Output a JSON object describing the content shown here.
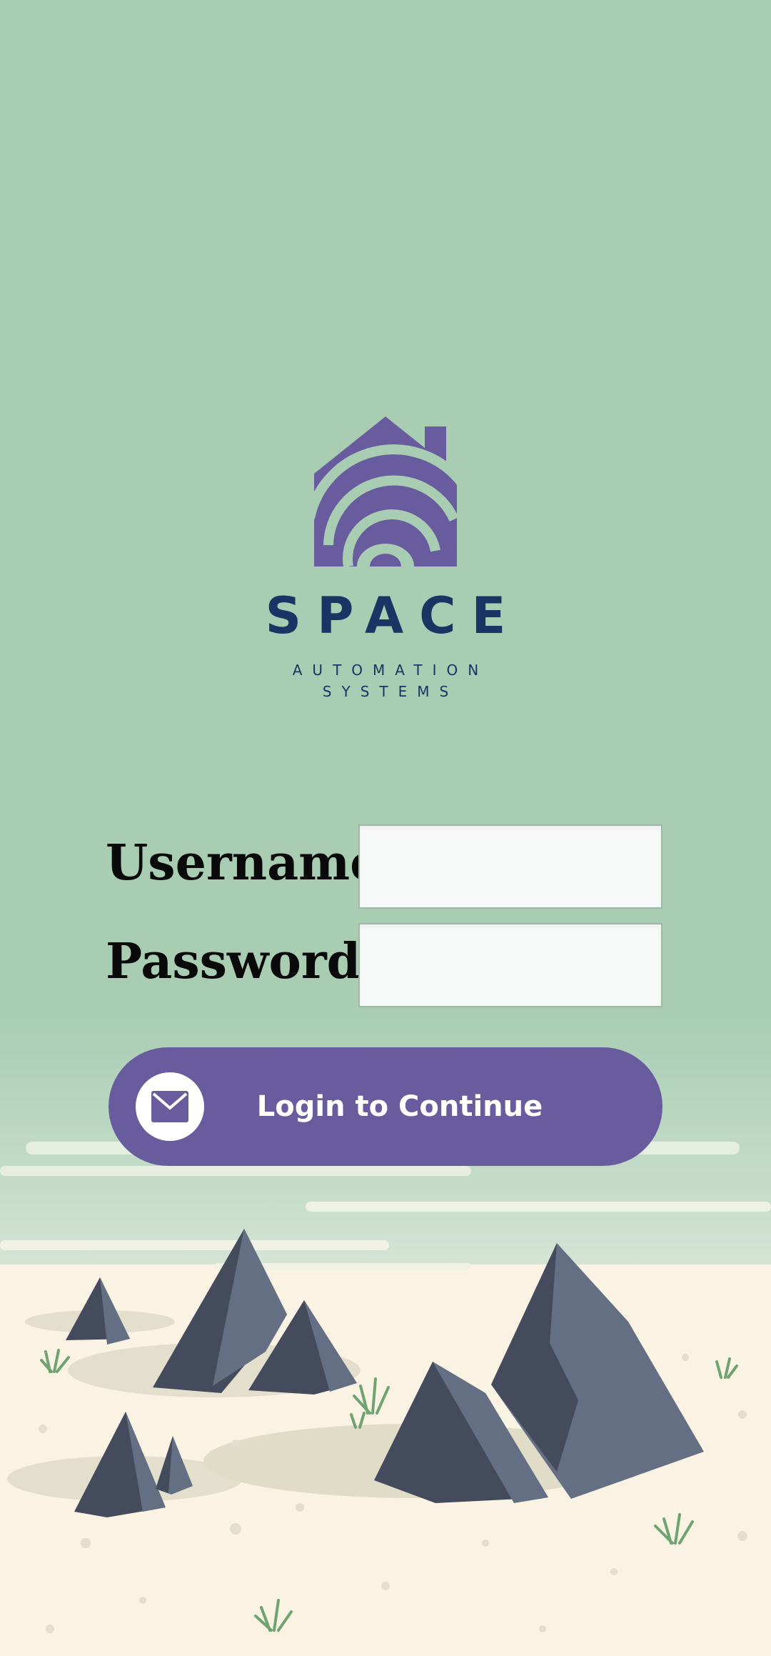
{
  "brand": {
    "name": "SPACE",
    "tagline_line1": "AUTOMATION",
    "tagline_line2": "SYSTEMS",
    "logo_icon": "house-wifi-icon",
    "logo_color": "#685c9f",
    "text_color": "#1b3464"
  },
  "login_form": {
    "username_label": "Username",
    "username_value": "",
    "password_label": "Password",
    "password_value": "",
    "submit_label": "Login to Continue",
    "submit_icon": "envelope-icon"
  },
  "colors": {
    "background": "#a8cdb3",
    "accent": "#685c9f",
    "ground": "#faf3e3",
    "rock_dark": "#444b5c",
    "rock_light": "#646f83"
  }
}
